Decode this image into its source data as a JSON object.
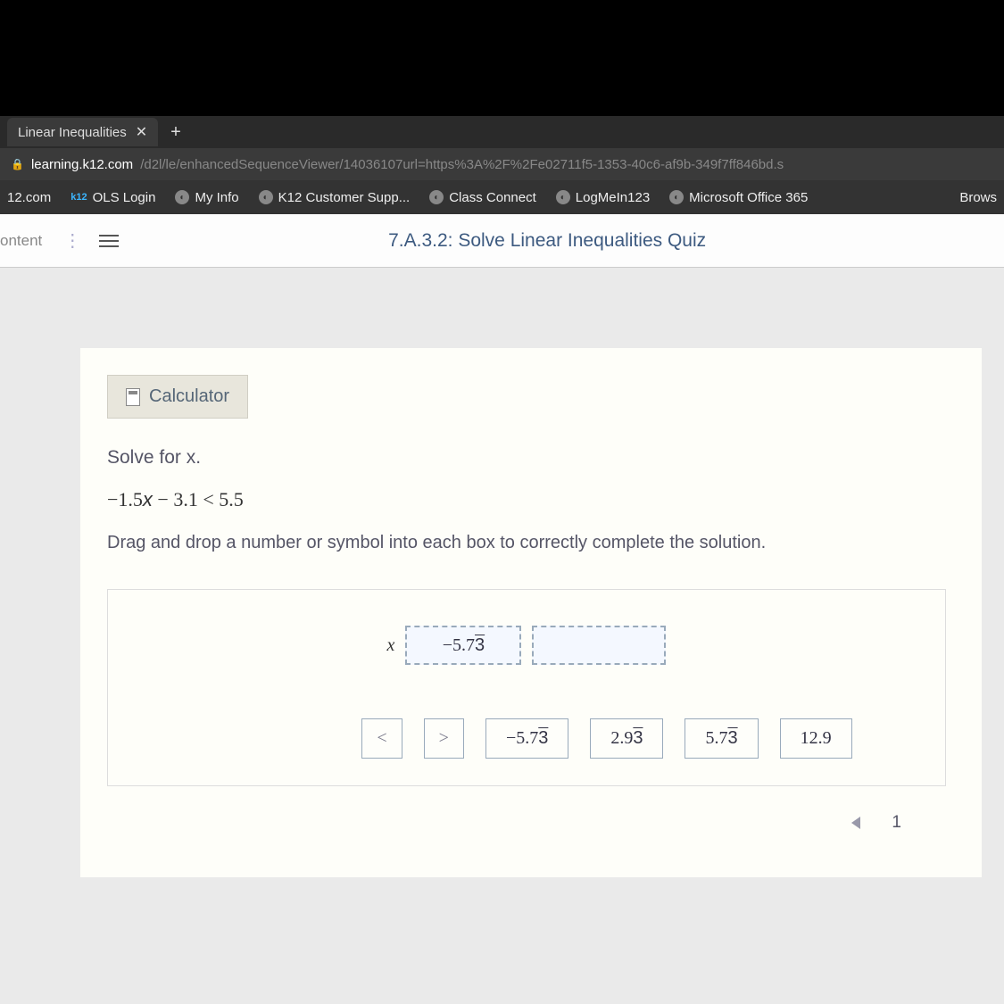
{
  "browser": {
    "tab_title": "Linear Inequalities",
    "url_domain": "learning.k12.com",
    "url_path": "/d2l/le/enhancedSequenceViewer/14036107url=https%3A%2F%2Fe02711f5-1353-40c6-af9b-349f7ff846bd.s",
    "bookmarks": [
      {
        "label": "12.com",
        "icon": ""
      },
      {
        "label": "OLS Login",
        "icon": "k12"
      },
      {
        "label": "My Info",
        "icon": "globe"
      },
      {
        "label": "K12 Customer Supp...",
        "icon": "globe"
      },
      {
        "label": "Class Connect",
        "icon": "globe"
      },
      {
        "label": "LogMeIn123",
        "icon": "globe"
      },
      {
        "label": "Microsoft Office 365",
        "icon": "globe"
      },
      {
        "label": "Brows",
        "icon": ""
      }
    ]
  },
  "page": {
    "nav_label": "ontent",
    "title": "7.A.3.2: Solve Linear Inequalities Quiz"
  },
  "quiz": {
    "calculator_label": "Calculator",
    "prompt": "Solve for x.",
    "equation": "−1.5x − 3.1 < 5.5",
    "instruction": "Drag and drop a number or symbol into each box to correctly complete the solution.",
    "answer": {
      "x_label": "x",
      "filled_value": "−5.73",
      "filled_overline": "3"
    },
    "choices": [
      {
        "label": "<",
        "type": "symbol"
      },
      {
        "label": ">",
        "type": "symbol"
      },
      {
        "label": "−5.73",
        "overline": "3",
        "type": "number"
      },
      {
        "label": "2.93",
        "overline": "3",
        "type": "number"
      },
      {
        "label": "5.73",
        "overline": "3",
        "type": "number"
      },
      {
        "label": "12.9",
        "type": "number"
      }
    ],
    "page_number": "1"
  }
}
